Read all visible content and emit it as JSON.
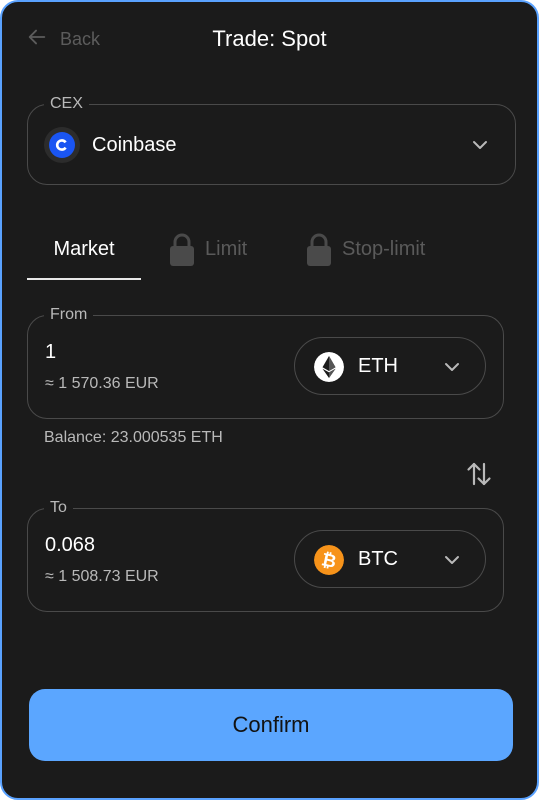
{
  "header": {
    "back_label": "Back",
    "title": "Trade: Spot"
  },
  "exchange": {
    "legend": "CEX",
    "selected": "Coinbase",
    "icon": "coinbase-logo"
  },
  "tabs": [
    {
      "label": "Market",
      "active": true,
      "locked": false
    },
    {
      "label": "Limit",
      "active": false,
      "locked": true
    },
    {
      "label": "Stop-limit",
      "active": false,
      "locked": true
    }
  ],
  "from": {
    "legend": "From",
    "amount": "1",
    "fiat": "≈ 1 570.36 EUR",
    "token": "ETH",
    "token_icon": "ethereum-icon"
  },
  "balance": "Balance: 23.000535 ETH",
  "to": {
    "legend": "To",
    "amount": "0.068",
    "fiat": "≈ 1 508.73 EUR",
    "token": "BTC",
    "token_icon": "bitcoin-icon"
  },
  "confirm_label": "Confirm",
  "colors": {
    "background": "#1b1b1b",
    "accent": "#5ba6ff",
    "border": "#4a4a4a",
    "muted_text": "#b9b9b9",
    "disabled_text": "#5a5a5a",
    "coinbase_blue": "#1a55f2",
    "bitcoin_orange": "#f7931a"
  }
}
